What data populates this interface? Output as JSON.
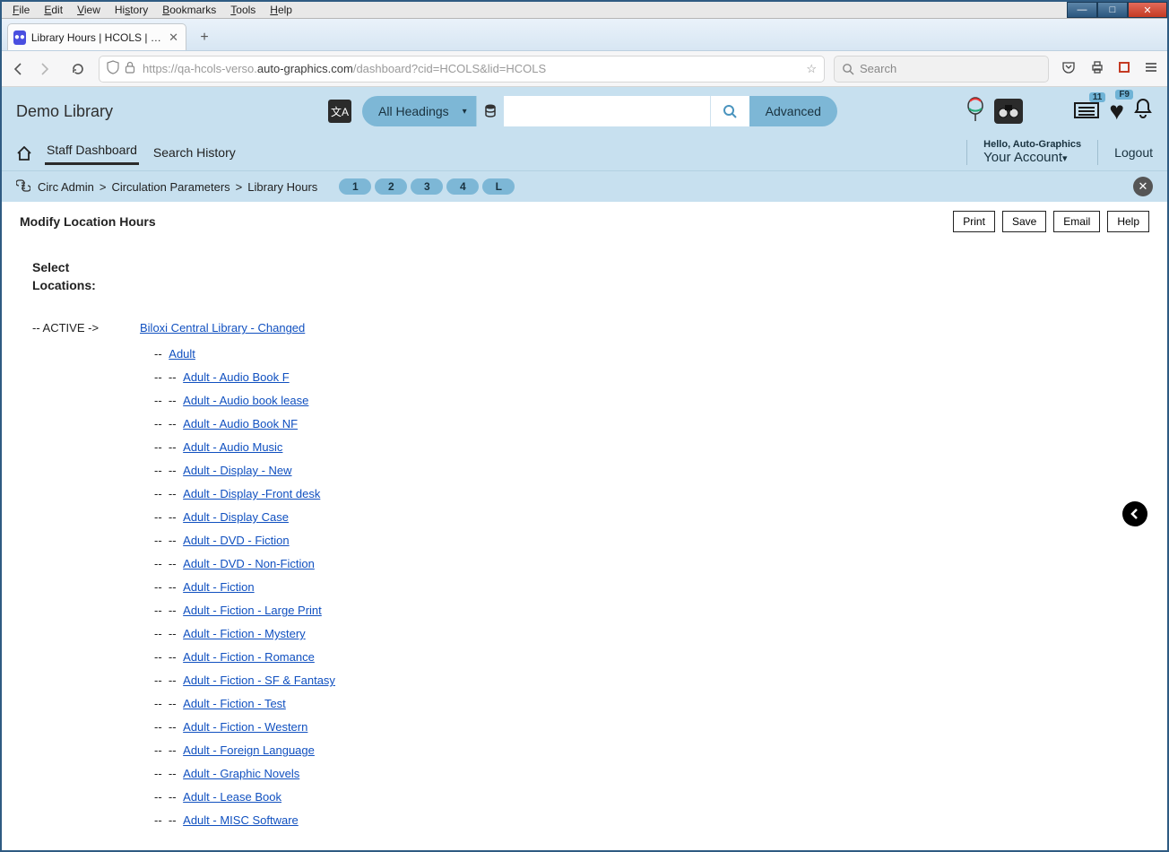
{
  "window": {
    "menus": [
      "File",
      "Edit",
      "View",
      "History",
      "Bookmarks",
      "Tools",
      "Help"
    ]
  },
  "browser": {
    "tab_title": "Library Hours | HCOLS | hcols | ",
    "url_prefix": "https://qa-hcols-verso.",
    "url_bold": "auto-graphics.com",
    "url_suffix": "/dashboard?cid=HCOLS&lid=HCOLS",
    "search_placeholder": "Search"
  },
  "header": {
    "library_name": "Demo Library",
    "headings_label": "All Headings",
    "advanced_label": "Advanced",
    "list_badge": "11",
    "heart_badge": "F9",
    "hello": "Hello, Auto-Graphics",
    "your_account": "Your Account",
    "logout": "Logout"
  },
  "secnav": {
    "staff_dashboard": "Staff Dashboard",
    "search_history": "Search History"
  },
  "breadcrumb": {
    "a": "Circ Admin",
    "b": "Circulation Parameters",
    "c": "Library Hours",
    "pages": [
      "1",
      "2",
      "3",
      "4",
      "L"
    ]
  },
  "page": {
    "title": "Modify Location Hours",
    "btn_print": "Print",
    "btn_save": "Save",
    "btn_email": "Email",
    "btn_help": "Help",
    "select_locations_1": "Select",
    "select_locations_2": "Locations:",
    "active_marker": "-- ACTIVE ->",
    "root_location": "Biloxi Central Library - Changed",
    "adult_label": "Adult",
    "sublocations": [
      "Adult - Audio Book F",
      "Adult - Audio book lease",
      "Adult - Audio Book NF",
      "Adult - Audio Music",
      "Adult - Display - New",
      "Adult - Display -Front desk",
      "Adult - Display Case",
      "Adult - DVD - Fiction",
      "Adult - DVD - Non-Fiction",
      "Adult - Fiction",
      "Adult - Fiction - Large Print",
      "Adult - Fiction - Mystery",
      "Adult - Fiction - Romance",
      "Adult - Fiction - SF & Fantasy",
      "Adult - Fiction - Test",
      "Adult - Fiction - Western",
      "Adult - Foreign Language",
      "Adult - Graphic Novels",
      "Adult - Lease Book",
      "Adult - MISC Software"
    ]
  }
}
